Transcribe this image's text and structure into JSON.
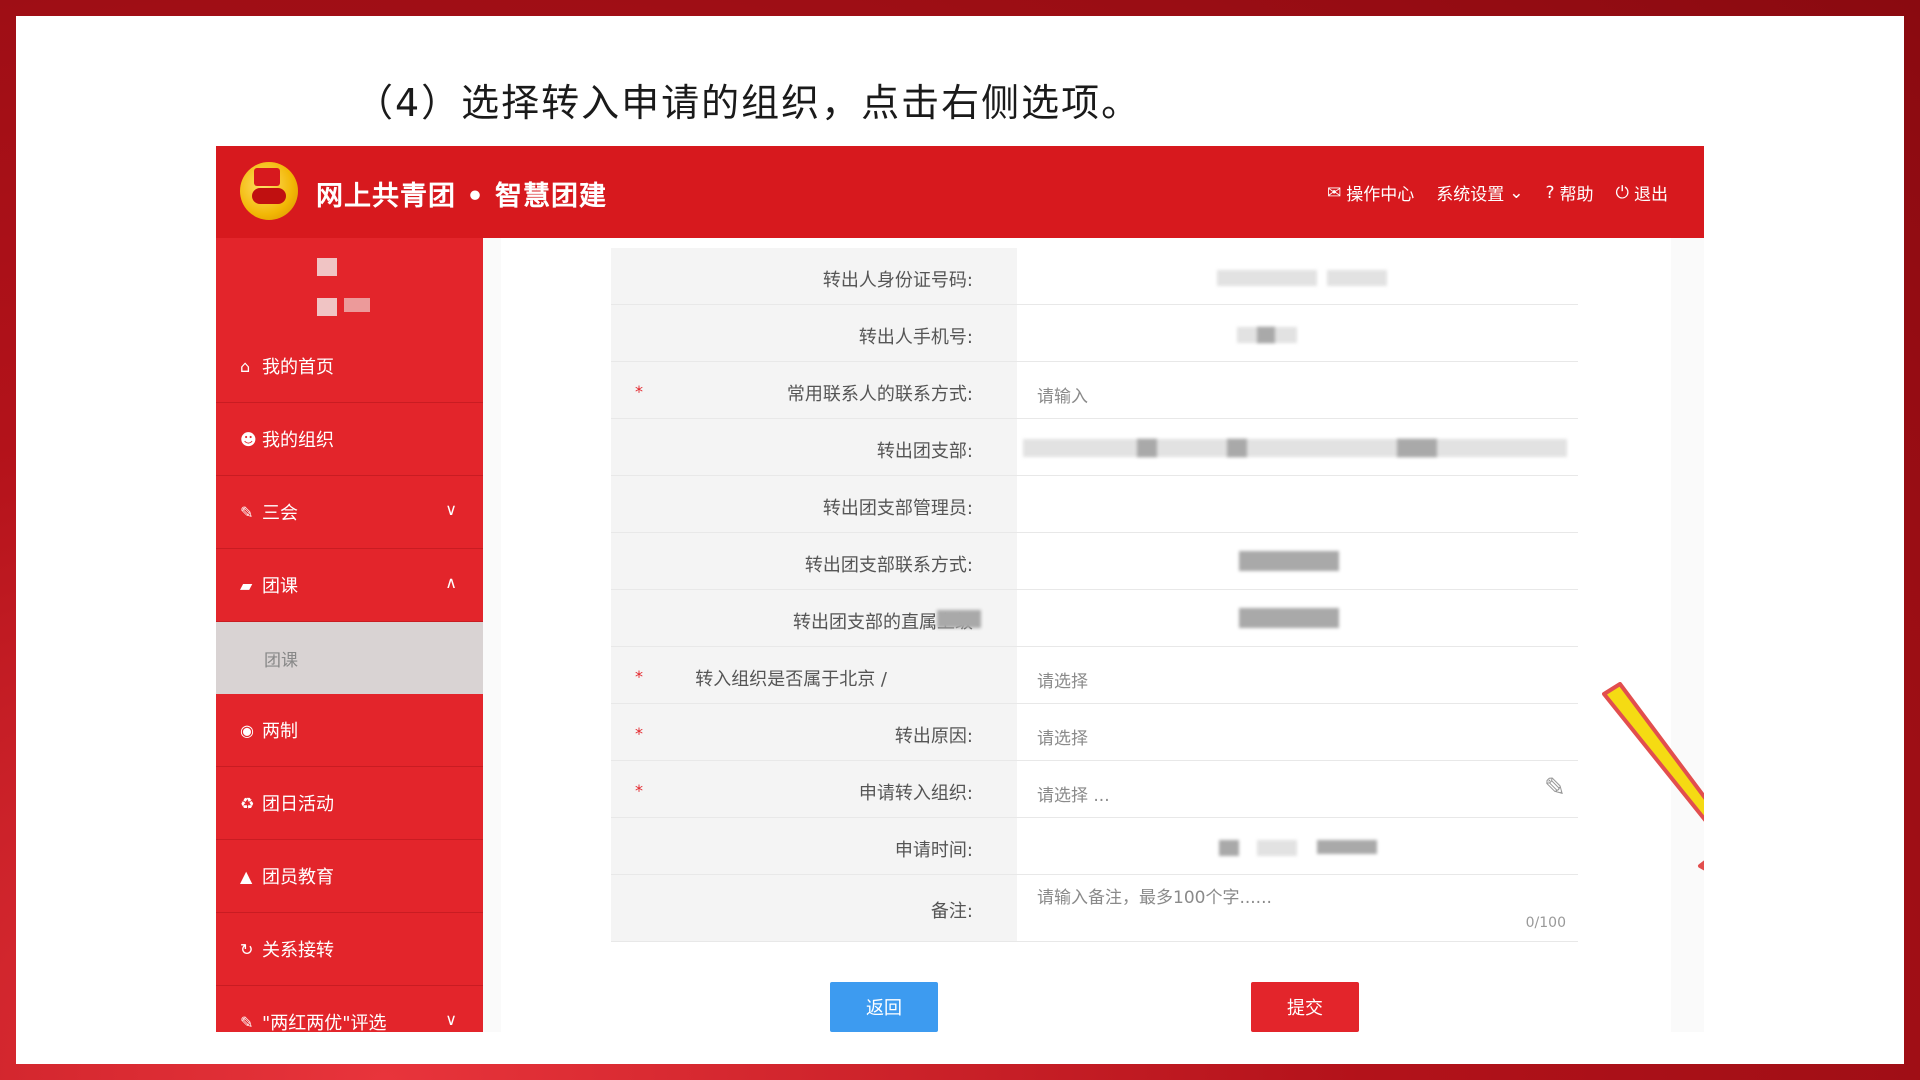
{
  "caption": "（4）选择转入申请的组织，点击右侧选项。",
  "header": {
    "title": "网上共青团 • 智慧团建",
    "nav": [
      {
        "icon": "envelope-icon",
        "label": "操作中心"
      },
      {
        "icon": "chevron-down-icon",
        "label": "系统设置"
      },
      {
        "icon": "help-icon",
        "label": "帮助"
      },
      {
        "icon": "power-icon",
        "label": "退出"
      }
    ]
  },
  "sidebar": {
    "items": [
      {
        "icon": "home-icon",
        "label": "我的首页"
      },
      {
        "icon": "group-icon",
        "label": "我的组织"
      },
      {
        "icon": "edit-square-icon",
        "label": "三会",
        "chevron": "down"
      },
      {
        "icon": "folder-icon",
        "label": "团课",
        "chevron": "up"
      },
      {
        "sub": true,
        "label": "团课"
      },
      {
        "icon": "target-icon",
        "label": "两制"
      },
      {
        "icon": "recycle-icon",
        "label": "团日活动"
      },
      {
        "icon": "graduation-cap-icon",
        "label": "团员教育"
      },
      {
        "icon": "refresh-icon",
        "label": "关系接转"
      },
      {
        "icon": "edit-square-icon",
        "label": "\"两红两优\"评选",
        "chevron": "down"
      }
    ]
  },
  "form": {
    "rows": [
      {
        "label": "转出人身份证号码:",
        "required": false,
        "value": ""
      },
      {
        "label": "转出人手机号:",
        "required": false,
        "value": ""
      },
      {
        "label": "常用联系人的联系方式:",
        "required": true,
        "placeholder": "请输入"
      },
      {
        "label": "转出团支部:",
        "required": false,
        "value": ""
      },
      {
        "label": "转出团支部管理员:",
        "required": false,
        "value": ""
      },
      {
        "label": "转出团支部联系方式:",
        "required": false,
        "value": ""
      },
      {
        "label": "转出团支部的直属上级",
        "required": false,
        "value": ""
      },
      {
        "label": "转入组织是否属于北京 / ",
        "required": true,
        "placeholder": "请选择"
      },
      {
        "label": "转出原因:",
        "required": true,
        "placeholder": "请选择"
      },
      {
        "label": "申请转入组织:",
        "required": true,
        "placeholder": "请选择 ..."
      },
      {
        "label": "申请时间:",
        "required": false,
        "value": ""
      },
      {
        "label": "备注:",
        "required": false,
        "placeholder": "请输入备注，最多100个字......",
        "counter": "0/100"
      }
    ],
    "required_mark": "*",
    "back_label": "返回",
    "submit_label": "提交"
  },
  "colors": {
    "brand_red": "#d7191e",
    "sidebar_red": "#e3252b",
    "back_blue": "#3d9bf0",
    "arrow_yellow": "#f5d800"
  }
}
